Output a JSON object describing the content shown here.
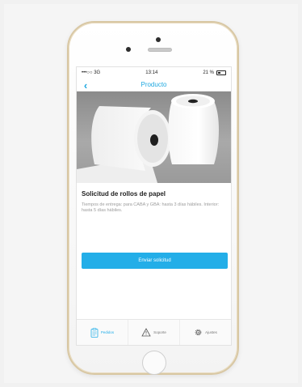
{
  "status_bar": {
    "carrier": "•••○○ 3G",
    "time": "13:14",
    "battery_text": "21 %"
  },
  "nav": {
    "title": "Producto",
    "back_icon": "chevron-left-icon"
  },
  "product": {
    "title": "Solicitud de rollos de papel",
    "description": "Tiempos de entrega: para CABA y GBA: hasta 3 días hábiles. Interior: hasta 5 días hábiles."
  },
  "actions": {
    "send_label": "Enviar solicitud"
  },
  "tabs": [
    {
      "label": "Pedidos",
      "icon": "clipboard-icon",
      "active": true
    },
    {
      "label": "Soporte",
      "icon": "warning-icon",
      "active": false
    },
    {
      "label": "Ajustes",
      "icon": "gear-icon",
      "active": false
    }
  ],
  "colors": {
    "accent": "#23aee8",
    "nav_tint": "#1fa8e0",
    "phone_gold": "#d8c7a3"
  }
}
